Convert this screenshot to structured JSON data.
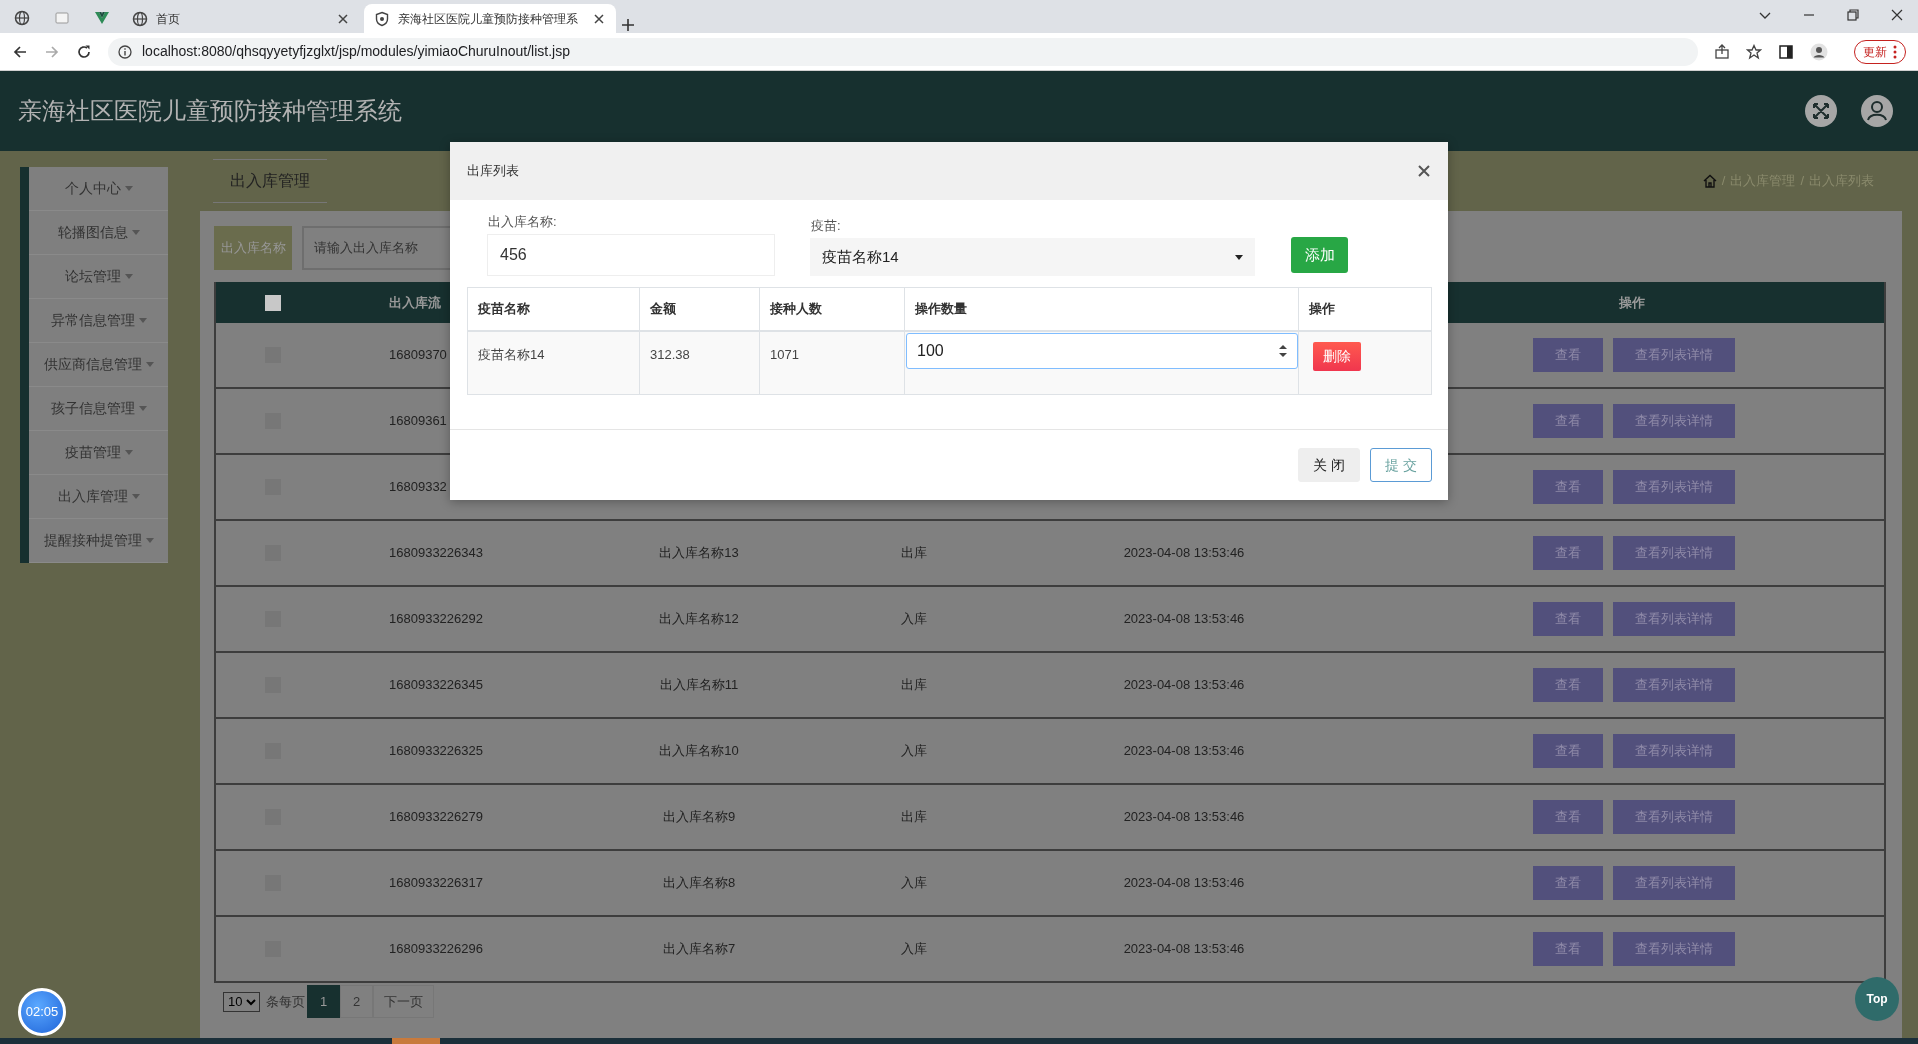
{
  "browser": {
    "tabs": [
      {
        "title": "首页",
        "selected": false
      },
      {
        "title": "亲海社区医院儿童预防接种管理系",
        "selected": true
      }
    ],
    "url": "localhost:8080/qhsqyyetyfjzglxt/jsp/modules/yimiaoChuruInout/list.jsp",
    "update_button": "更新"
  },
  "header": {
    "title": "亲海社区医院儿童预防接种管理系统"
  },
  "sidebar": {
    "items": [
      "个人中心",
      "轮播图信息",
      "论坛管理",
      "异常信息管理",
      "供应商信息管理",
      "孩子信息管理",
      "疫苗管理",
      "出入库管理",
      "提醒接种提管理"
    ]
  },
  "page_title": "出入库管理",
  "breadcrumb": {
    "separator": "/",
    "items": [
      "出入库管理",
      "出入库列表"
    ]
  },
  "search": {
    "label": "出入库名称",
    "placeholder": "请输入出入库名称"
  },
  "table": {
    "select_all_checked": false,
    "columns": [
      "出入库流",
      "操作"
    ],
    "rows": [
      {
        "checked": false,
        "serial": "16809370",
        "actions": [
          "查看",
          "查看列表详情"
        ]
      },
      {
        "checked": false,
        "serial": "16809361",
        "actions": [
          "查看",
          "查看列表详情"
        ]
      },
      {
        "checked": false,
        "serial": "16809332",
        "actions": [
          "查看",
          "查看列表详情"
        ]
      },
      {
        "checked": false,
        "serial": "1680933226343",
        "name": "出入库名称13",
        "type": "出库",
        "time": "2023-04-08 13:53:46",
        "actions": [
          "查看",
          "查看列表详情"
        ]
      },
      {
        "checked": false,
        "serial": "1680933226292",
        "name": "出入库名称12",
        "type": "入库",
        "time": "2023-04-08 13:53:46",
        "actions": [
          "查看",
          "查看列表详情"
        ]
      },
      {
        "checked": false,
        "serial": "1680933226345",
        "name": "出入库名称11",
        "type": "出库",
        "time": "2023-04-08 13:53:46",
        "actions": [
          "查看",
          "查看列表详情"
        ]
      },
      {
        "checked": false,
        "serial": "1680933226325",
        "name": "出入库名称10",
        "type": "入库",
        "time": "2023-04-08 13:53:46",
        "actions": [
          "查看",
          "查看列表详情"
        ]
      },
      {
        "checked": false,
        "serial": "1680933226279",
        "name": "出入库名称9",
        "type": "出库",
        "time": "2023-04-08 13:53:46",
        "actions": [
          "查看",
          "查看列表详情"
        ]
      },
      {
        "checked": false,
        "serial": "1680933226317",
        "name": "出入库名称8",
        "type": "入库",
        "time": "2023-04-08 13:53:46",
        "actions": [
          "查看",
          "查看列表详情"
        ]
      },
      {
        "checked": false,
        "serial": "1680933226296",
        "name": "出入库名称7",
        "type": "入库",
        "time": "2023-04-08 13:53:46",
        "actions": [
          "查看",
          "查看列表详情"
        ]
      }
    ]
  },
  "pagination": {
    "page_size": "10",
    "page_size_label": "条每页",
    "pages": [
      {
        "label": "1",
        "selected": true
      },
      {
        "label": "2",
        "selected": false
      }
    ],
    "next": "下一页"
  },
  "timer": "02:05",
  "top_button": "Top",
  "modal": {
    "title": "出库列表",
    "name_field": {
      "label": "出入库名称:",
      "value": "456"
    },
    "vaccine_field": {
      "label": "疫苗:",
      "value": "疫苗名称14"
    },
    "add_button": "添加",
    "columns": [
      "疫苗名称",
      "金额",
      "接种人数",
      "操作数量",
      "操作"
    ],
    "rows": [
      {
        "name": "疫苗名称14",
        "amount": "312.38",
        "count": "1071",
        "quantity": "100",
        "action": "删除"
      }
    ],
    "buttons": [
      {
        "label": "关 闭",
        "kind": "secondary"
      },
      {
        "label": "提 交",
        "kind": "primary"
      }
    ]
  }
}
